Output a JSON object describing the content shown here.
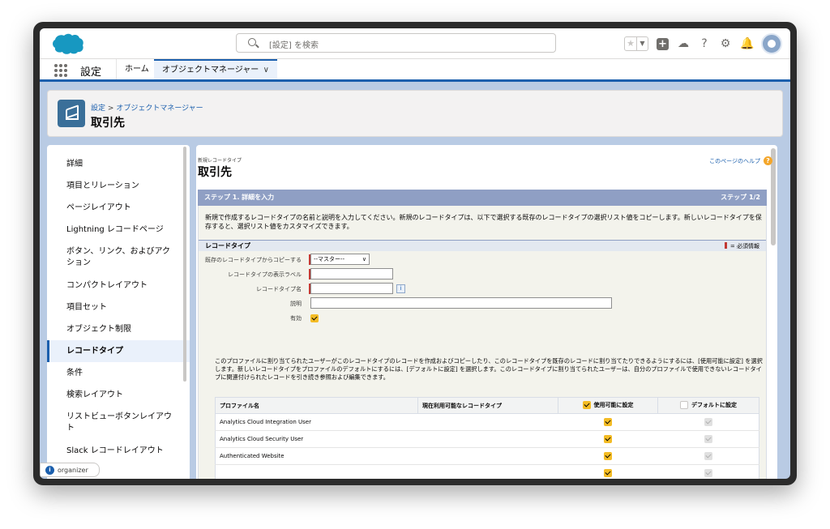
{
  "header": {
    "search_placeholder": "[設定] を検索"
  },
  "nav": {
    "app_name": "設定",
    "tabs": [
      {
        "label": "ホーム"
      },
      {
        "label": "オブジェクトマネージャー"
      }
    ]
  },
  "page_header": {
    "breadcrumb_root": "設定",
    "breadcrumb_sep": ">",
    "breadcrumb_child": "オブジェクトマネージャー",
    "title": "取引先"
  },
  "sidebar": {
    "items": [
      {
        "label": "詳細"
      },
      {
        "label": "項目とリレーション"
      },
      {
        "label": "ページレイアウト"
      },
      {
        "label": "Lightning レコードページ"
      },
      {
        "label": "ボタン、リンク、およびアクション"
      },
      {
        "label": "コンパクトレイアウト"
      },
      {
        "label": "項目セット"
      },
      {
        "label": "オブジェクト制限"
      },
      {
        "label": "レコードタイプ"
      },
      {
        "label": "条件"
      },
      {
        "label": "検索レイアウト"
      },
      {
        "label": "リストビューボタンレイアウト"
      },
      {
        "label": "Slack レコードレイアウト"
      }
    ]
  },
  "main": {
    "subtitle": "新規レコードタイプ",
    "title": "取引先",
    "help_link": "このページのヘルプ",
    "step_title": "ステップ 1. 詳細を入力",
    "step_count": "ステップ 1/2",
    "step_desc": "新規で作成するレコードタイプの名前と説明を入力してください。新規のレコードタイプは、以下で選択する既存のレコードタイプの選択リスト値をコピーします。新しいレコードタイプを保存すると、選択リスト値をカスタマイズできます。",
    "section_title": "レコードタイプ",
    "required_info": "= 必須情報",
    "fields": {
      "copy_from_label": "既存のレコードタイプからコピーする",
      "copy_from_value": "--マスター--",
      "display_label_label": "レコードタイプの表示ラベル",
      "name_label": "レコードタイプ名",
      "description_label": "説明",
      "active_label": "有効"
    },
    "note": "このプロファイルに割り当てられたユーザーがこのレコードタイプのレコードを作成およびコピーしたり、このレコードタイプを既存のレコードに割り当てたりできるようにするには、[使用可能に設定] を選択します。新しいレコードタイプをプロファイルのデフォルトにするには、[デフォルトに設定] を選択します。このレコードタイプに割り当てられたユーザーは、自分のプロファイルで使用できないレコードタイプに関連付けられたレコードを引き続き参照および編集できます。",
    "table": {
      "headers": {
        "profile": "プロファイル名",
        "current": "現在利用可能なレコードタイプ",
        "enable": "使用可能に設定",
        "default": "デフォルトに設定"
      },
      "rows": [
        {
          "profile": "Analytics Cloud Integration User"
        },
        {
          "profile": "Analytics Cloud Security User"
        },
        {
          "profile": "Authenticated Website"
        },
        {
          "profile": ""
        }
      ]
    }
  },
  "organizer": {
    "label": "organizer"
  },
  "colors": {
    "brand_blue": "#1b5fad",
    "step_bar": "#8f9fc4",
    "checkbox_yellow": "#f4bc25",
    "required_red": "#c23934"
  }
}
